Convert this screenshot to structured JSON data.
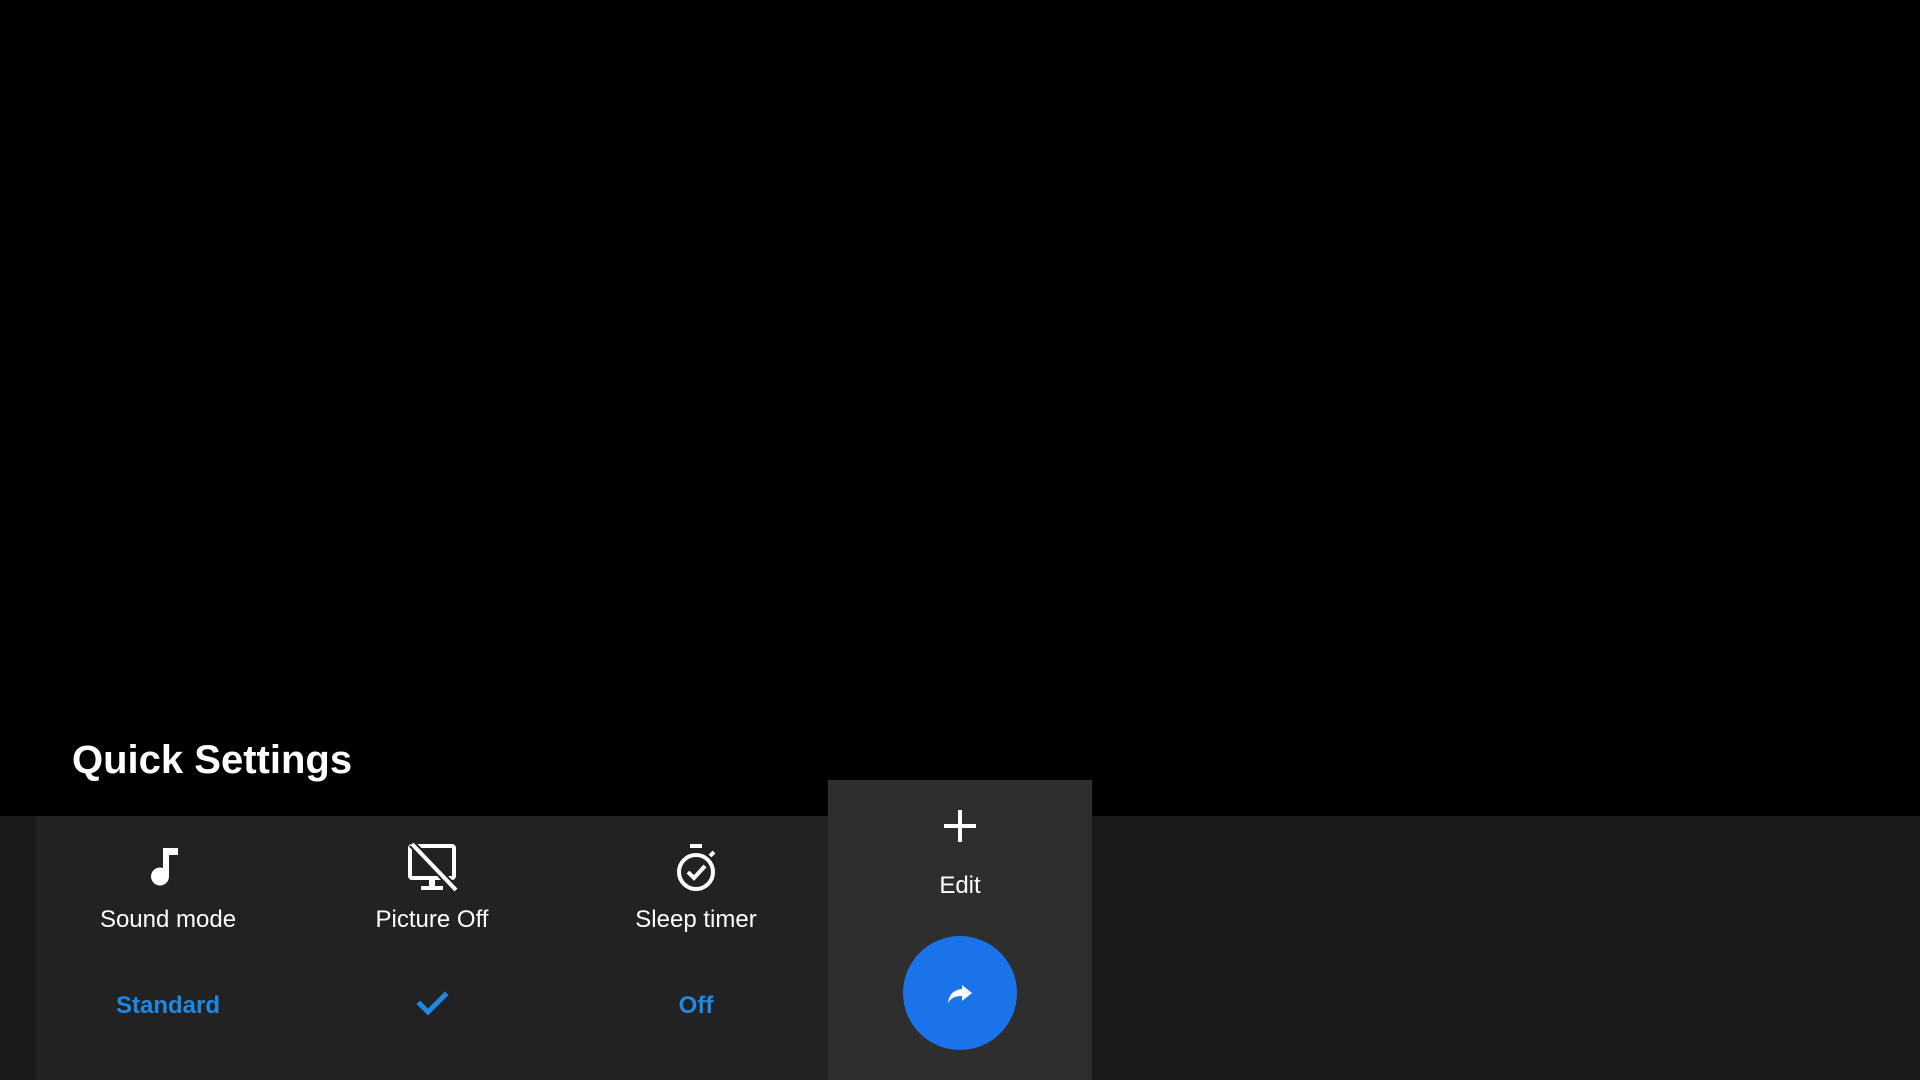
{
  "header": {
    "title": "Quick Settings"
  },
  "tiles": [
    {
      "label": "Sound mode",
      "value": "Standard",
      "icon": "music-note-icon"
    },
    {
      "label": "Picture Off",
      "value": "",
      "icon": "monitor-off-icon",
      "state": "checked"
    },
    {
      "label": "Sleep timer",
      "value": "Off",
      "icon": "timer-icon"
    }
  ],
  "edit": {
    "label": "Edit",
    "icon": "plus-icon",
    "action_icon": "share-arrow-icon"
  },
  "colors": {
    "background": "#000000",
    "panel": "#1a1a1a",
    "tile": "#222222",
    "edit_tile": "#2e2e2e",
    "accent": "#1e88e5",
    "button": "#1a73e8",
    "text": "#ffffff"
  }
}
